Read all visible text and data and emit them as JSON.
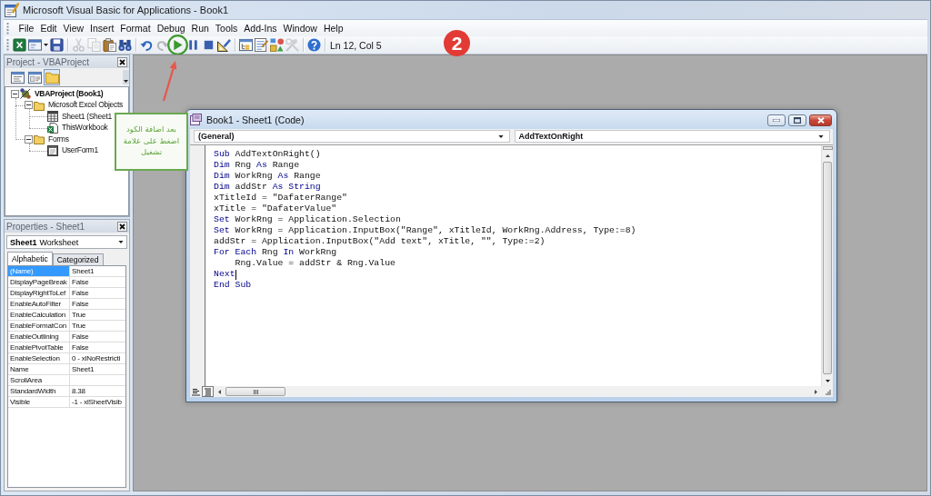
{
  "window": {
    "title": "Microsoft Visual Basic for Applications - Book1"
  },
  "menu": [
    "File",
    "Edit",
    "View",
    "Insert",
    "Format",
    "Debug",
    "Run",
    "Tools",
    "Add-Ins",
    "Window",
    "Help"
  ],
  "toolbar": {
    "groups": [
      [
        {
          "kind": "spreadsheet",
          "disabled": false,
          "highlighted": false
        },
        {
          "kind": "insert_form",
          "disabled": false,
          "highlighted": false
        },
        {
          "kind": "save",
          "disabled": false,
          "highlighted": false
        }
      ],
      [
        {
          "kind": "cut",
          "disabled": true,
          "highlighted": false
        },
        {
          "kind": "copy",
          "disabled": true,
          "highlighted": false
        },
        {
          "kind": "paste",
          "disabled": false,
          "highlighted": false
        },
        {
          "kind": "find",
          "disabled": false,
          "highlighted": false
        }
      ],
      [
        {
          "kind": "undo",
          "disabled": false,
          "highlighted": false
        },
        {
          "kind": "redo",
          "disabled": true,
          "highlighted": false
        },
        {
          "kind": "run",
          "disabled": false,
          "highlighted": true
        },
        {
          "kind": "break",
          "disabled": false,
          "highlighted": false
        },
        {
          "kind": "reset",
          "disabled": false,
          "highlighted": false
        },
        {
          "kind": "design_mode",
          "disabled": false,
          "highlighted": false
        }
      ],
      [
        {
          "kind": "project_explorer",
          "disabled": false,
          "highlighted": false
        },
        {
          "kind": "properties",
          "disabled": false,
          "highlighted": false
        },
        {
          "kind": "object_browser",
          "disabled": false,
          "highlighted": false
        },
        {
          "kind": "toolbox",
          "disabled": true,
          "highlighted": false
        }
      ],
      [
        {
          "kind": "help",
          "disabled": false,
          "highlighted": false
        }
      ]
    ],
    "cursor_position": "Ln 12, Col 5"
  },
  "project": {
    "title": "Project - VBAProject",
    "toolbar": [
      {
        "kind": "view_code",
        "pressed": false
      },
      {
        "kind": "view_object",
        "pressed": false
      },
      {
        "kind": "toggle_folders",
        "pressed": true
      }
    ],
    "tree": [
      {
        "label": "VBAProject (Book1)",
        "kind": "project",
        "expanded": true,
        "children": [
          {
            "label": "Microsoft Excel Objects",
            "kind": "folder",
            "expanded": true,
            "children": [
              {
                "label": "Sheet1 (Sheet1",
                "kind": "sheet"
              },
              {
                "label": "ThisWorkbook",
                "kind": "workbook"
              }
            ]
          },
          {
            "label": "Forms",
            "kind": "folder",
            "expanded": true,
            "children": [
              {
                "label": "UserForm1",
                "kind": "form"
              }
            ]
          }
        ]
      }
    ]
  },
  "properties": {
    "title": "Properties - Sheet1",
    "object": {
      "name": "Sheet1",
      "type": "Worksheet"
    },
    "tabs": [
      {
        "label": "Alphabetic",
        "selected": true
      },
      {
        "label": "Categorized",
        "selected": false
      }
    ],
    "rows": [
      {
        "name": "(Name)",
        "value": "Sheet1",
        "selected": true
      },
      {
        "name": "DisplayPageBreak",
        "value": "False",
        "selected": false
      },
      {
        "name": "DisplayRightToLef",
        "value": "False",
        "selected": false
      },
      {
        "name": "EnableAutoFilter",
        "value": "False",
        "selected": false
      },
      {
        "name": "EnableCalculation",
        "value": "True",
        "selected": false
      },
      {
        "name": "EnableFormatCon",
        "value": "True",
        "selected": false
      },
      {
        "name": "EnableOutlining",
        "value": "False",
        "selected": false
      },
      {
        "name": "EnablePivotTable",
        "value": "False",
        "selected": false
      },
      {
        "name": "EnableSelection",
        "value": "0 - xlNoRestricti",
        "selected": false
      },
      {
        "name": "Name",
        "value": "Sheet1",
        "selected": false
      },
      {
        "name": "ScrollArea",
        "selected": false
      },
      {
        "name": "StandardWidth",
        "value": "8.38",
        "selected": false
      },
      {
        "name": "Visible",
        "value": "-1 - xlSheetVisib",
        "selected": false
      }
    ]
  },
  "code_window": {
    "title": "Book1 - Sheet1 (Code)",
    "object": "(General)",
    "procedure": "AddTextOnRight",
    "lines": [
      {
        "segments": [
          {
            "text": "Sub",
            "kind": "keyword"
          },
          {
            "text": " AddTextOnRight()",
            "kind": "plain"
          }
        ],
        "cursor": false
      },
      {
        "segments": [
          {
            "text": "Dim",
            "kind": "keyword"
          },
          {
            "text": " Rng ",
            "kind": "plain"
          },
          {
            "text": "As",
            "kind": "keyword"
          },
          {
            "text": " Range",
            "kind": "plain"
          }
        ],
        "cursor": false
      },
      {
        "segments": [
          {
            "text": "Dim",
            "kind": "keyword"
          },
          {
            "text": " WorkRng ",
            "kind": "plain"
          },
          {
            "text": "As",
            "kind": "keyword"
          },
          {
            "text": " Range",
            "kind": "plain"
          }
        ],
        "cursor": false
      },
      {
        "segments": [
          {
            "text": "Dim",
            "kind": "keyword"
          },
          {
            "text": " addStr ",
            "kind": "plain"
          },
          {
            "text": "As String",
            "kind": "keyword"
          }
        ],
        "cursor": false
      },
      {
        "segments": [
          {
            "text": "xTitleId = \"DafaterRange\"",
            "kind": "plain"
          }
        ],
        "cursor": false
      },
      {
        "segments": [
          {
            "text": "xTitle = \"DafaterValue\"",
            "kind": "plain"
          }
        ],
        "cursor": false
      },
      {
        "segments": [
          {
            "text": "Set",
            "kind": "keyword"
          },
          {
            "text": " WorkRng = Application.Selection",
            "kind": "plain"
          }
        ],
        "cursor": false
      },
      {
        "segments": [
          {
            "text": "Set",
            "kind": "keyword"
          },
          {
            "text": " WorkRng = Application.InputBox(\"Range\", xTitleId, WorkRng.Address, Type:=8)",
            "kind": "plain"
          }
        ],
        "cursor": false
      },
      {
        "segments": [
          {
            "text": "addStr = Application.InputBox(\"Add text\", xTitle, \"\", Type:=2)",
            "kind": "plain"
          }
        ],
        "cursor": false
      },
      {
        "segments": [
          {
            "text": "For Each",
            "kind": "keyword"
          },
          {
            "text": " Rng ",
            "kind": "plain"
          },
          {
            "text": "In",
            "kind": "keyword"
          },
          {
            "text": " WorkRng",
            "kind": "plain"
          }
        ],
        "cursor": false
      },
      {
        "segments": [
          {
            "text": "    Rng.Value = addStr & Rng.Value",
            "kind": "plain"
          }
        ],
        "cursor": false
      },
      {
        "segments": [
          {
            "text": "Next",
            "kind": "keyword"
          }
        ],
        "cursor": true
      },
      {
        "segments": [
          {
            "text": "End Sub",
            "kind": "keyword"
          }
        ],
        "cursor": false
      }
    ],
    "view_buttons": [
      {
        "kind": "procedure",
        "selected": false
      },
      {
        "kind": "full_module",
        "selected": true
      }
    ]
  },
  "annotations": {
    "callout": "بعد اضافة الكود اضغط على علامة تشغيل",
    "step_badge": "2"
  }
}
